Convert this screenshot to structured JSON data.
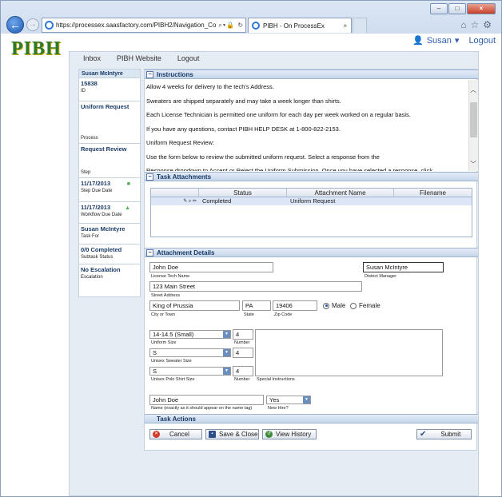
{
  "browser": {
    "url": "https://processex.saasfactory.com/PIBH2/Navigation_Co",
    "tab_title": "PIBH - On ProcessEx",
    "tab_close": "×",
    "window_controls": [
      "–",
      "□",
      "×"
    ],
    "toolbar_icons": [
      "home-icon",
      "star-icon",
      "gear-icon"
    ]
  },
  "header": {
    "logo": "PIBH",
    "user_name": "Susan",
    "logout": "Logout"
  },
  "nav": {
    "items": [
      "Inbox",
      "PIBH Website",
      "Logout"
    ]
  },
  "left_panel": {
    "user": "Susan McIntyre",
    "id": {
      "value": "15838",
      "label": "ID"
    },
    "process": {
      "value": "Uniform Request",
      "label": "Process"
    },
    "step": {
      "value": "Request Review",
      "label": "Step"
    },
    "step_due": {
      "value": "11/17/2013",
      "label": "Step Due Date"
    },
    "workflow_due": {
      "value": "11/17/2013",
      "label": "Workflow Due Date"
    },
    "task_for": {
      "value": "Susan McIntyre",
      "label": "Task For"
    },
    "subtask": {
      "value": "0/0 Completed",
      "label": "Subtask Status"
    },
    "escalation": {
      "value": "No Escalation",
      "label": "Escalation"
    }
  },
  "instructions": {
    "title": "Instructions",
    "lines": [
      "Allow 4 weeks for delivery to the tech's Address.",
      "Sweaters are shipped separately and may take a week longer than shirts.",
      "Each License Technician is permitted one uniform for each day per week worked on a regular basis.",
      "If you have any questions, contact PIBH HELP DESK at 1-800-822-2153.",
      "Uniform Request Review:",
      "Use the form below to review the submitted uniform request. Select a response from the",
      "Response dropdown to Accept or Reject the Uniform Submission.  Once you have selected a response, click"
    ]
  },
  "task_attachments": {
    "title": "Task Attachments",
    "columns": [
      "Status",
      "Attachment Name",
      "Filename"
    ],
    "rows": [
      {
        "status": "Completed",
        "name": "Uniform Request",
        "filename": ""
      }
    ]
  },
  "attachment_details": {
    "title": "Attachment Details",
    "tech_name": {
      "value": "John Doe",
      "label": "License Tech Name"
    },
    "district_manager": {
      "value": "Susan McIntyre",
      "label": "District Manager"
    },
    "street": {
      "value": "123 Main Street",
      "label": "Street Address"
    },
    "city": {
      "value": "King of Prussia",
      "label": "City or Town"
    },
    "state": {
      "value": "PA",
      "label": "State"
    },
    "zip": {
      "value": "19406",
      "label": "Zip Code"
    },
    "gender": {
      "male": "Male",
      "female": "Female",
      "selected": "Male"
    },
    "uniform_size": {
      "value": "14-14.5 (Small)",
      "label": "Uniform Size",
      "number": "4",
      "number_label": "Number"
    },
    "sweater_size": {
      "value": "S",
      "label": "Unisex Sweater Size",
      "number": "4",
      "number_label": "Number"
    },
    "polo_size": {
      "value": "S",
      "label": "Unisex Polo Shirt Size",
      "number": "4",
      "number_label": "Number"
    },
    "special": {
      "value": "",
      "label": "Special Instructions"
    },
    "name_tag": {
      "value": "John Doe",
      "label": "Name (exactly as it should appear on the name tag)"
    },
    "new_hire": {
      "value": "Yes",
      "label": "New Hire?"
    }
  },
  "task_actions": {
    "title": "Task Actions",
    "cancel": "Cancel",
    "save_close": "Save & Close",
    "view_history": "View History",
    "submit": "Submit"
  },
  "colors": {
    "accent": "#2f5fae",
    "header_bg": "#c6d6eb",
    "logo_green": "#2d7a2a"
  }
}
